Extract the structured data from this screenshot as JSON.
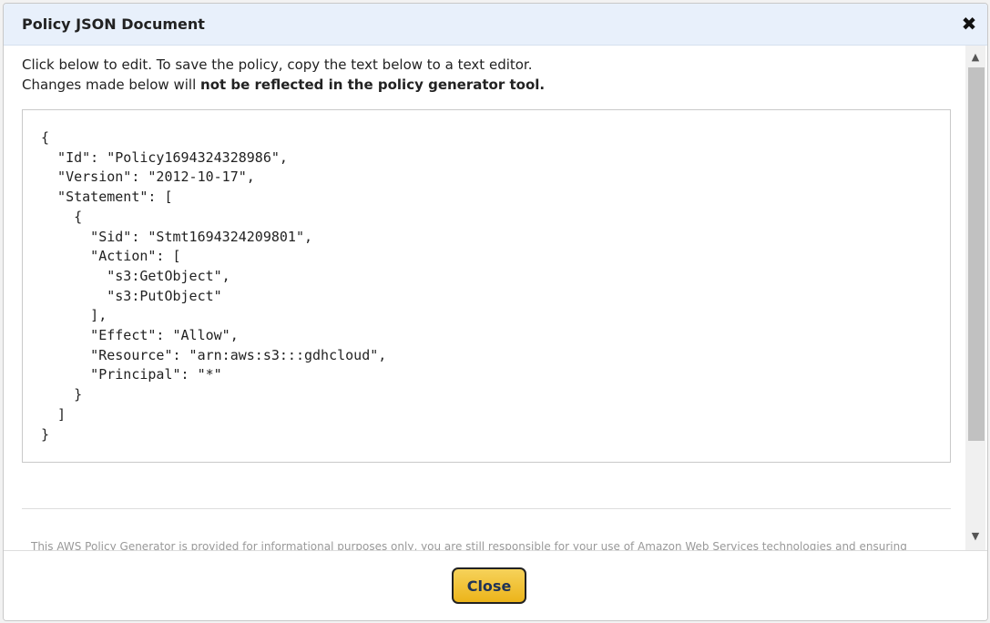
{
  "dialog": {
    "title": "Policy JSON Document",
    "close_icon": "close-icon"
  },
  "intro": {
    "line1": "Click below to edit. To save the policy, copy the text below to a text editor.",
    "line2_prefix": "Changes made below will ",
    "line2_bold": "not be reflected in the policy generator tool."
  },
  "policy_json": "{\n  \"Id\": \"Policy1694324328986\",\n  \"Version\": \"2012-10-17\",\n  \"Statement\": [\n    {\n      \"Sid\": \"Stmt1694324209801\",\n      \"Action\": [\n        \"s3:GetObject\",\n        \"s3:PutObject\"\n      ],\n      \"Effect\": \"Allow\",\n      \"Resource\": \"arn:aws:s3:::gdhcloud\",\n      \"Principal\": \"*\"\n    }\n  ]\n}",
  "disclaimer": "This AWS Policy Generator is provided for informational purposes only, you are still responsible for your use of Amazon Web Services technologies and ensuring",
  "scrollbar": {
    "up_icon": "chevron-up-icon",
    "down_icon": "chevron-down-icon"
  },
  "footer": {
    "close_label": "Close"
  },
  "colors": {
    "titlebar_bg": "#e8f0fb",
    "button_gold": "#ecb41a",
    "button_text": "#1f3357"
  }
}
